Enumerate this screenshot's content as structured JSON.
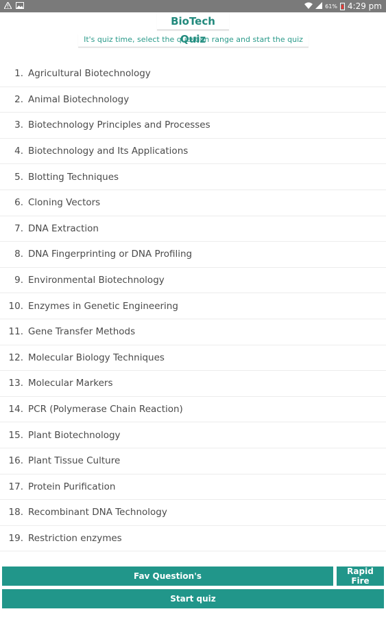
{
  "status_bar": {
    "left_icons": [
      "warning-icon",
      "image-icon"
    ],
    "battery_percent": "61%",
    "time": "4:29 pm"
  },
  "header": {
    "title": "BioTech Quiz",
    "subtitle": "It's quiz time, select the question range and start the quiz"
  },
  "topics": [
    {
      "num": "1.",
      "label": "Agricultural Biotechnology"
    },
    {
      "num": "2.",
      "label": "Animal Biotechnology"
    },
    {
      "num": "3.",
      "label": "Biotechnology Principles and Processes"
    },
    {
      "num": "4.",
      "label": "Biotechnology and Its Applications"
    },
    {
      "num": "5.",
      "label": "Blotting Techniques"
    },
    {
      "num": "6.",
      "label": "Cloning Vectors"
    },
    {
      "num": "7.",
      "label": "DNA Extraction"
    },
    {
      "num": "8.",
      "label": "DNA Fingerprinting or DNA Profiling"
    },
    {
      "num": "9.",
      "label": "Environmental Biotechnology"
    },
    {
      "num": "10.",
      "label": "Enzymes in Genetic Engineering"
    },
    {
      "num": "11.",
      "label": "Gene Transfer Methods"
    },
    {
      "num": "12.",
      "label": "Molecular Biology Techniques"
    },
    {
      "num": "13.",
      "label": "Molecular Markers"
    },
    {
      "num": "14.",
      "label": "PCR (Polymerase Chain Reaction)"
    },
    {
      "num": "15.",
      "label": "Plant Biotechnology"
    },
    {
      "num": "16.",
      "label": "Plant Tissue Culture"
    },
    {
      "num": "17.",
      "label": "Protein Purification"
    },
    {
      "num": "18.",
      "label": "Recombinant DNA Technology"
    },
    {
      "num": "19.",
      "label": "Restriction enzymes"
    }
  ],
  "buttons": {
    "fav_label": "Fav Question's",
    "rapid_label": "Rapid Fire",
    "start_label": "Start quiz"
  },
  "colors": {
    "accent": "#21968a",
    "title": "#21897c",
    "status_bar": "#7a7a7a",
    "battery_low": "#e53935"
  }
}
